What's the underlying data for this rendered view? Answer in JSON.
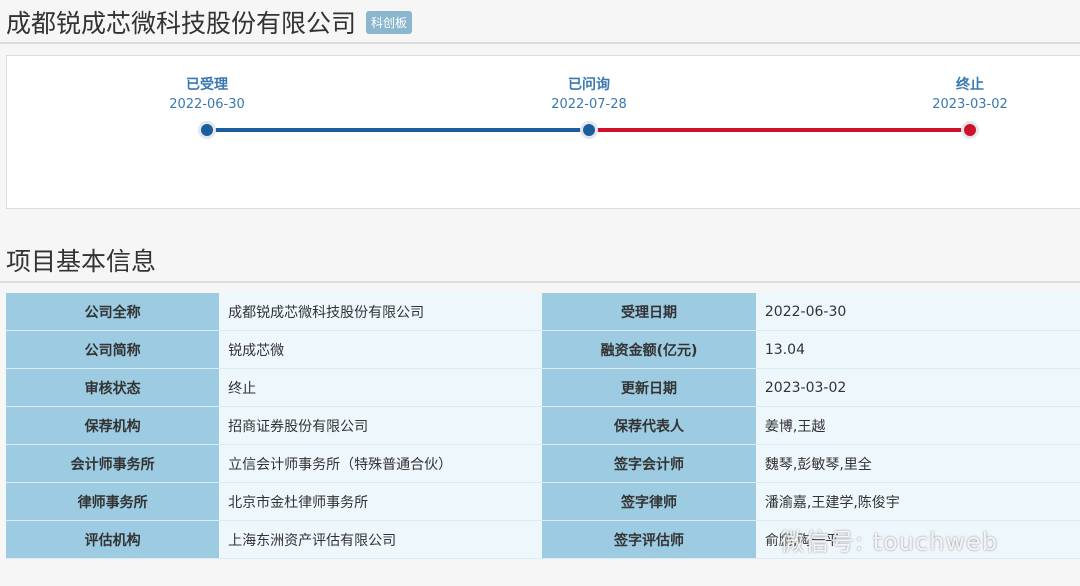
{
  "header": {
    "title": "成都锐成芯微科技股份有限公司",
    "board": "科创板"
  },
  "timeline": [
    {
      "label": "已受理",
      "date": "2022-06-30"
    },
    {
      "label": "已问询",
      "date": "2022-07-28"
    },
    {
      "label": "终止",
      "date": "2023-03-02"
    }
  ],
  "colors": {
    "blue": "#1a5ea0",
    "red": "#d0112b"
  },
  "section_title": "项目基本信息",
  "rows": [
    {
      "k1": "公司全称",
      "v1": "成都锐成芯微科技股份有限公司",
      "k2": "受理日期",
      "v2": "2022-06-30"
    },
    {
      "k1": "公司简称",
      "v1": "锐成芯微",
      "k2": "融资金额(亿元)",
      "v2": "13.04"
    },
    {
      "k1": "审核状态",
      "v1": "终止",
      "k2": "更新日期",
      "v2": "2023-03-02"
    },
    {
      "k1": "保荐机构",
      "v1": "招商证券股份有限公司",
      "k2": "保荐代表人",
      "v2": "姜博,王越"
    },
    {
      "k1": "会计师事务所",
      "v1": "立信会计师事务所（特殊普通合伙）",
      "k2": "签字会计师",
      "v2": "魏琴,彭敏琴,里全"
    },
    {
      "k1": "律师事务所",
      "v1": "北京市金杜律师事务所",
      "k2": "签字律师",
      "v2": "潘渝嘉,王建学,陈俊宇"
    },
    {
      "k1": "评估机构",
      "v1": "上海东洲资产评估有限公司",
      "k2": "签字评估师",
      "v2": "俞鹏,陶一平"
    }
  ],
  "watermark": "微信号: touchweb"
}
